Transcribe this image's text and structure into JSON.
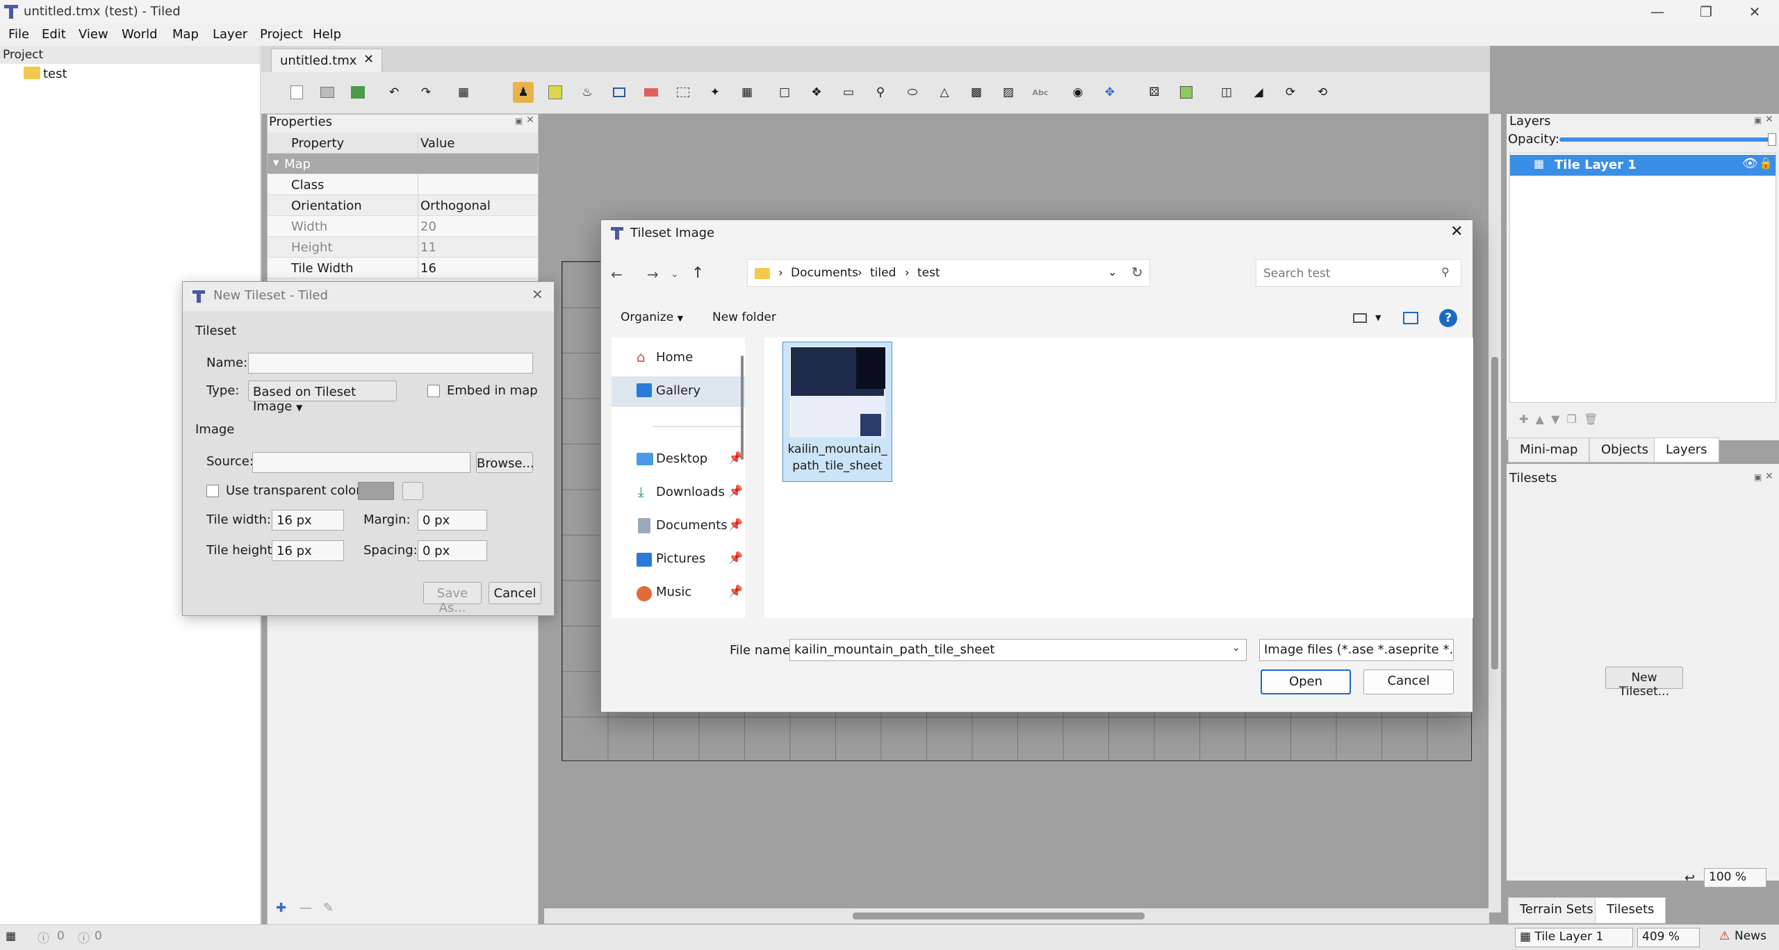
{
  "window": {
    "title": "untitled.tmx (test) - Tiled"
  },
  "menu": [
    "File",
    "Edit",
    "View",
    "World",
    "Map",
    "Layer",
    "Project",
    "Help"
  ],
  "project": {
    "header": "Project",
    "item": "test"
  },
  "editor": {
    "tab": "untitled.tmx"
  },
  "properties": {
    "header": "Properties",
    "col_property": "Property",
    "col_value": "Value",
    "section": "Map",
    "rows": [
      {
        "k": "Class",
        "v": ""
      },
      {
        "k": "Orientation",
        "v": "Orthogonal"
      },
      {
        "k": "Width",
        "v": "20"
      },
      {
        "k": "Height",
        "v": "11"
      },
      {
        "k": "Tile Width",
        "v": "16"
      }
    ]
  },
  "layers": {
    "header": "Layers",
    "opacity_label": "Opacity:",
    "layer_name": "Tile Layer 1",
    "tabs": [
      "Mini-map",
      "Objects",
      "Layers"
    ]
  },
  "tilesets": {
    "header": "Tilesets",
    "new_button": "New Tileset...",
    "tabs": [
      "Terrain Sets",
      "Tilesets"
    ]
  },
  "statusbar": {
    "warnings": "0",
    "errors": "0",
    "layer": "Tile Layer 1",
    "zoom": "409 %",
    "news": "News",
    "zoom2": "100 %"
  },
  "new_tileset": {
    "title": "New Tileset - Tiled",
    "tileset_group": "Tileset",
    "name_label": "Name:",
    "name_value": "",
    "type_label": "Type:",
    "type_value": "Based on Tileset Image",
    "embed_label": "Embed in map",
    "image_group": "Image",
    "source_label": "Source:",
    "source_value": "",
    "browse": "Browse...",
    "transparent_label": "Use transparent color:",
    "tile_width_label": "Tile width:",
    "tile_width": "16 px",
    "tile_height_label": "Tile height:",
    "tile_height": "16 px",
    "margin_label": "Margin:",
    "margin": "0 px",
    "spacing_label": "Spacing:",
    "spacing": "0 px",
    "save_as": "Save As...",
    "cancel": "Cancel"
  },
  "file_dialog": {
    "title": "Tileset Image",
    "breadcrumb": [
      "Documents",
      "tiled",
      "test"
    ],
    "search_placeholder": "Search test",
    "organize": "Organize",
    "new_folder": "New folder",
    "nav": [
      "Home",
      "Gallery",
      "Desktop",
      "Downloads",
      "Documents",
      "Pictures",
      "Music"
    ],
    "file": {
      "name_line1": "kailin_mountain_",
      "name_line2": "path_tile_sheet"
    },
    "file_name_label": "File name:",
    "file_name_value": "kailin_mountain_path_tile_sheet",
    "file_type": "Image files (*.ase *.aseprite *.bn",
    "open": "Open",
    "cancel": "Cancel"
  },
  "colors": {
    "accent": "#3a8ee6",
    "selection": "#cce4f7"
  }
}
